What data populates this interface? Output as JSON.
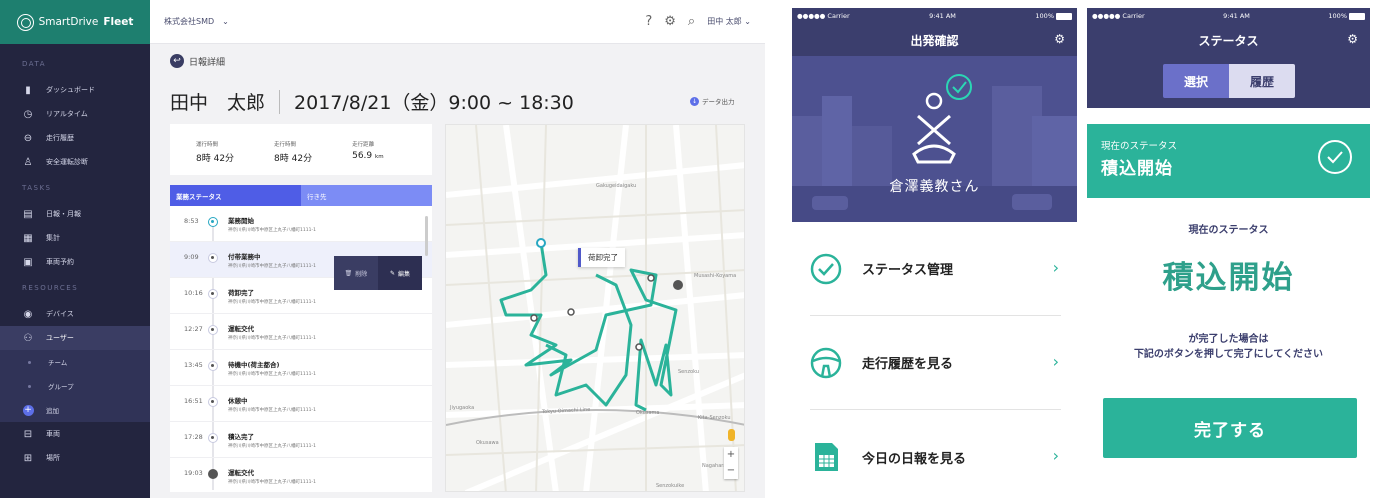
{
  "web": {
    "brand": {
      "prefix": "SmartDrive",
      "bold": "Fleet"
    },
    "sidebar": {
      "sections": {
        "data": "DATA",
        "tasks": "TASKS",
        "resources": "RESOURCES"
      },
      "items": [
        {
          "label": "ダッシュボード"
        },
        {
          "label": "リアルタイム"
        },
        {
          "label": "走行履歴"
        },
        {
          "label": "安全運転診断"
        },
        {
          "label": "日報・月報"
        },
        {
          "label": "集計"
        },
        {
          "label": "車両予約"
        },
        {
          "label": "デバイス"
        },
        {
          "label": "ユーザー"
        },
        {
          "label": "チーム"
        },
        {
          "label": "グループ"
        },
        {
          "label": "追加"
        },
        {
          "label": "車両"
        },
        {
          "label": "場所"
        }
      ]
    },
    "topbar": {
      "company": "株式会社SMD",
      "user": "田中 太郎"
    },
    "page": {
      "back_label": "日報詳細",
      "driver": "田中　太郎",
      "datetime": "2017/8/21（金）9:00 ~ 18:30",
      "export": "データ出力"
    },
    "stats": [
      {
        "label": "運行時間",
        "value": "8時 42分"
      },
      {
        "label": "走行時間",
        "value": "8時 42分"
      },
      {
        "label": "走行距離",
        "value": "56.9",
        "unit": "km"
      }
    ],
    "tabs": [
      "業務ステータス",
      "行き先"
    ],
    "events": [
      {
        "time": "8:53",
        "name": "業務開始",
        "addr": "神奈川県川崎市中原区上丸子八幡町1111-1"
      },
      {
        "time": "9:09",
        "name": "付帯業務中",
        "addr": "神奈川県川崎市中原区上丸子八幡町1111-1"
      },
      {
        "time": "10:16",
        "name": "荷卸完了",
        "addr": "神奈川県川崎市中原区上丸子八幡町1111-1"
      },
      {
        "time": "12:27",
        "name": "運転交代",
        "addr": "神奈川県川崎市中原区上丸子八幡町1111-1"
      },
      {
        "time": "13:45",
        "name": "待機中(荷主都合)",
        "addr": "神奈川県川崎市中原区上丸子八幡町1111-1"
      },
      {
        "time": "16:51",
        "name": "休憩中",
        "addr": "神奈川県川崎市中原区上丸子八幡町1111-1"
      },
      {
        "time": "17:28",
        "name": "積込完了",
        "addr": "神奈川県川崎市中原区上丸子八幡町1111-1"
      },
      {
        "time": "19:03",
        "name": "運転交代",
        "addr": "神奈川県川崎市中原区上丸子八幡町1111-1"
      }
    ],
    "actions": {
      "delete": "削除",
      "edit": "編集"
    },
    "map": {
      "tooltip": "荷卸完了",
      "labels": [
        "Gakugeidaigaku",
        "Musashi-Koyama",
        "Senzoku",
        "Jiyugaoka",
        "Tokyu Oimachi Line",
        "Okusawa",
        "Okusama",
        "Kita-Senzoku",
        "Nagahara",
        "Senzokuike"
      ],
      "route_color": "#2bb39a"
    }
  },
  "phone1": {
    "status": {
      "carrier": "●●●●● Carrier",
      "time": "9:41 AM",
      "battery": "100%"
    },
    "title": "出発確認",
    "name": "倉澤義教さん",
    "menu": [
      {
        "label": "ステータス管理",
        "icon": "check-circle-icon"
      },
      {
        "label": "走行履歴を見る",
        "icon": "steering-wheel-icon"
      },
      {
        "label": "今日の日報を見る",
        "icon": "report-icon"
      }
    ]
  },
  "phone2": {
    "status": {
      "carrier": "●●●●● Carrier",
      "time": "9:41 AM",
      "battery": "100%"
    },
    "title": "ステータス",
    "segments": [
      "選択",
      "履歴"
    ],
    "banner_small": "現在のステータス",
    "banner_big": "積込開始",
    "current_label": "現在のステータス",
    "current_value": "積込開始",
    "message_line1": "が完了した場合は",
    "message_line2": "下記のボタンを押して完了にしてください",
    "button": "完了する"
  }
}
